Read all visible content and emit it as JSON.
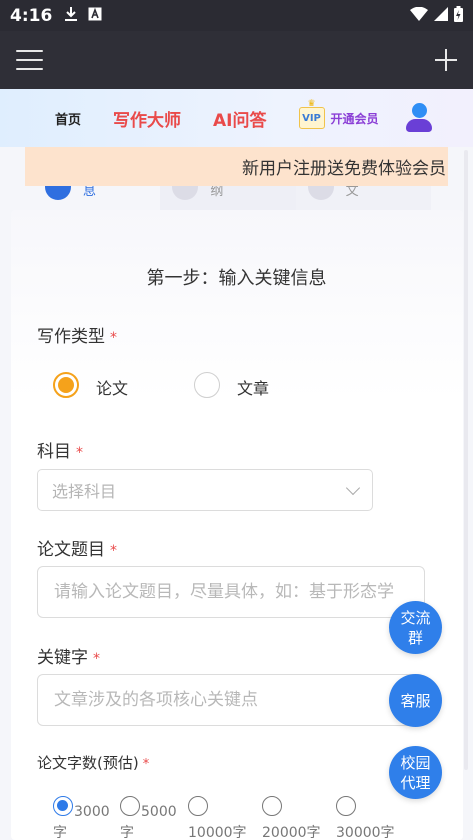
{
  "statusbar": {
    "time": "4:16",
    "download_icon": "download-icon",
    "a_icon": "a-badge-icon"
  },
  "appbar": {
    "menu_icon": "hamburger-icon",
    "add_icon": "plus-icon"
  },
  "nav": {
    "home": "首页",
    "writing_master": "写作大师",
    "ai_qa": "AI问答",
    "vip_badge": "VIP",
    "vip_label": "开通会员"
  },
  "banner": {
    "text": "新用户注册送免费体验会员"
  },
  "steps": [
    {
      "label": "息"
    },
    {
      "label": "纲"
    },
    {
      "label": "文"
    }
  ],
  "form": {
    "title": "第一步：输入关键信息",
    "required_mark": "*",
    "writing_type": {
      "label": "写作类型",
      "options": [
        "论文",
        "文章"
      ],
      "selected": "论文"
    },
    "subject": {
      "label": "科目",
      "placeholder": "选择科目"
    },
    "paper_title": {
      "label": "论文题目",
      "placeholder": "请输入论文题目，尽量具体，如：基于形态学"
    },
    "keywords": {
      "label": "关键字",
      "placeholder": "文章涉及的各项核心关键点"
    },
    "word_count": {
      "label": "论文字数(预估)",
      "options": [
        "3000字",
        "5000字",
        "10000字",
        "20000字",
        "30000字"
      ],
      "selected": "3000字"
    }
  },
  "fabs": {
    "group": "交流群",
    "service": "客服",
    "campus": "校园代理"
  },
  "colors": {
    "accent_red": "#e94a4a",
    "radio_orange": "#f5a21b",
    "fab_blue": "#2f7fea",
    "banner_bg": "#fde3cd"
  }
}
